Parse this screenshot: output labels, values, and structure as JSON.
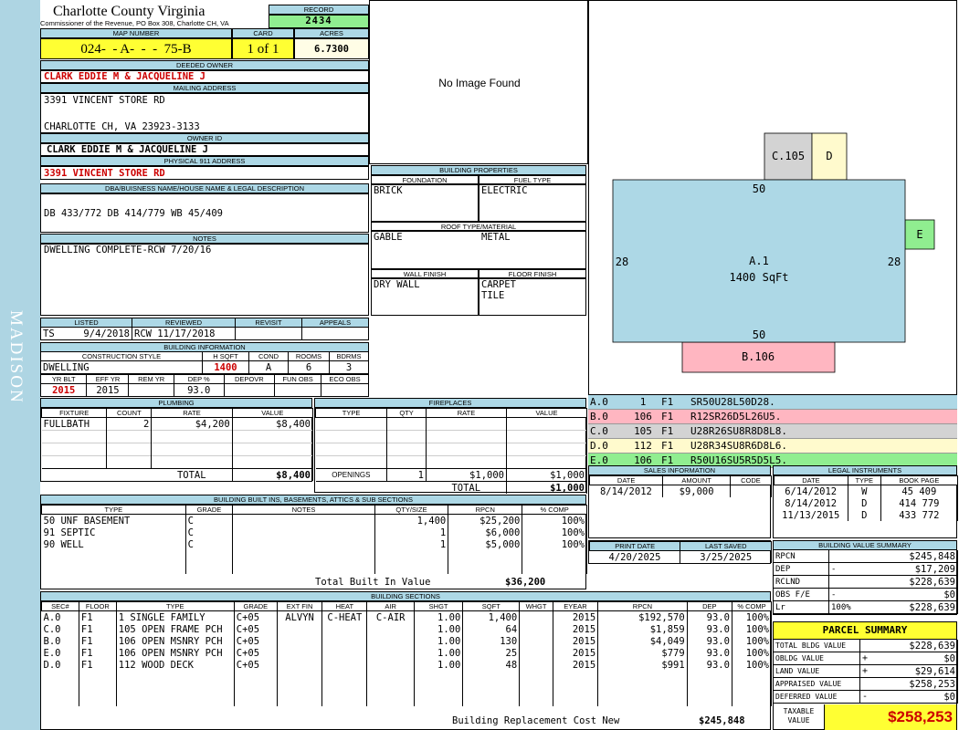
{
  "sidebar_label": "MADISON",
  "header": {
    "county": "Charlotte County Virginia",
    "commissioner": "Commissioner of the Revenue, PO Box 308, Charlotte CH, VA",
    "record_label": "RECORD",
    "record_value": "2434",
    "map_label": "MAP NUMBER",
    "map_value": "024-  - A-  -  -  75-B",
    "card_label": "CARD",
    "card_value": "1 of 1",
    "acres_label": "ACRES",
    "acres_value": "6.7300"
  },
  "owner": {
    "deeded_label": "DEEDED OWNER",
    "deeded_value": "CLARK EDDIE M & JACQUELINE J",
    "mailing_label": "MAILING ADDRESS",
    "mailing_line1": "3391 VINCENT STORE RD",
    "mailing_line2": "CHARLOTTE CH, VA 23923-3133",
    "owner_id_label": "OWNER ID",
    "owner_id_value": "CLARK EDDIE M & JACQUELINE J",
    "physical_label": "PHYSICAL 911 ADDRESS",
    "physical_value": "3391 VINCENT STORE RD",
    "dba_label": "DBA/BUISNESS NAME/HOUSE NAME & LEGAL DESCRIPTION",
    "dba_value": "DB 433/772 DB 414/779 WB 45/409",
    "notes_label": "NOTES",
    "notes_value": "DWELLING COMPLETE-RCW 7/20/16"
  },
  "image": {
    "no_image": "No Image Found"
  },
  "building_properties": {
    "title": "BUILDING PROPERTIES",
    "foundation_label": "FOUNDATION",
    "foundation_value": "BRICK",
    "fuel_label": "FUEL TYPE",
    "fuel_value": "ELECTRIC",
    "roof_label": "ROOF TYPE/MATERIAL",
    "roof_type": "GABLE",
    "roof_material": "METAL",
    "wall_label": "WALL FINISH",
    "wall_value": "DRY WALL",
    "floor_label": "FLOOR FINISH",
    "floor_value1": "CARPET",
    "floor_value2": "TILE"
  },
  "listing": {
    "listed_label": "LISTED",
    "listed_by": "TS",
    "listed_date": "9/4/2018",
    "reviewed_label": "REVIEWED",
    "reviewed_value": "RCW 11/17/2018",
    "revisit_label": "REVISIT",
    "appeals_label": "APPEALS"
  },
  "building_info": {
    "title": "BUILDING INFORMATION",
    "style_label": "CONSTRUCTION STYLE",
    "style_value": "DWELLING",
    "hsqft_label": "H SQFT",
    "hsqft_value": "1400",
    "cond_label": "COND",
    "cond_value": "A",
    "rooms_label": "ROOMS",
    "rooms_value": "6",
    "bdrms_label": "BDRMS",
    "bdrms_value": "3",
    "yrblt_label": "YR BLT",
    "yrblt_value": "2015",
    "effyr_label": "EFF YR",
    "effyr_value": "2015",
    "remyr_label": "REM YR",
    "remyr_value": "",
    "dep_label": "DEP %",
    "dep_value": "93.0",
    "depovr_label": "DEPOVR",
    "funobs_label": "FUN OBS",
    "ecoobs_label": "ECO OBS"
  },
  "plumbing": {
    "title": "PLUMBING",
    "cols": [
      "FIXTURE",
      "COUNT",
      "RATE",
      "VALUE"
    ],
    "rows": [
      {
        "fixture": "FULLBATH",
        "count": "2",
        "rate": "$4,200",
        "value": "$8,400"
      }
    ],
    "total_label": "TOTAL",
    "total_value": "$8,400"
  },
  "fireplaces": {
    "title": "FIREPLACES",
    "cols": [
      "TYPE",
      "QTY",
      "RATE",
      "VALUE"
    ],
    "openings_label": "OPENINGS",
    "openings_qty": "1",
    "openings_rate": "$1,000",
    "openings_value": "$1,000",
    "total_label": "TOTAL",
    "total_value": "$1,000"
  },
  "sketch": {
    "main_label": "A.1",
    "main_area": "1400 SqFt",
    "top_dim": "50",
    "bottom_dim": "50",
    "left_dim": "28",
    "right_dim": "28",
    "c_label": "C.105",
    "d_label": "D",
    "e_label": "E",
    "b_label": "B.106",
    "colors": {
      "main": "#add8e6",
      "c": "#d3d3d3",
      "d": "#fffacd",
      "e": "#90ee90",
      "b": "#ffb6c1"
    }
  },
  "sketch_legend": [
    {
      "code": "A.0",
      "num": "1",
      "floor": "F1",
      "path": "SR50U28L50D28.",
      "color": "#add8e6"
    },
    {
      "code": "B.0",
      "num": "106",
      "floor": "F1",
      "path": "R12SR26D5L26U5.",
      "color": "#ffb6c1"
    },
    {
      "code": "C.0",
      "num": "105",
      "floor": "F1",
      "path": "U28R26SU8R8D8L8.",
      "color": "#d3d3d3"
    },
    {
      "code": "D.0",
      "num": "112",
      "floor": "F1",
      "path": "U28R34SU8R6D8L6.",
      "color": "#fffacd"
    },
    {
      "code": "E.0",
      "num": "106",
      "floor": "F1",
      "path": "R50U16SU5R5D5L5.",
      "color": "#90ee90"
    }
  ],
  "sales": {
    "title": "SALES INFORMATION",
    "cols": [
      "DATE",
      "AMOUNT",
      "CODE"
    ],
    "rows": [
      {
        "date": "8/14/2012",
        "amount": "$9,000",
        "code": ""
      }
    ]
  },
  "legal": {
    "title": "LEGAL INSTRUMENTS",
    "cols": [
      "DATE",
      "TYPE",
      "BOOK PAGE"
    ],
    "rows": [
      {
        "date": "6/14/2012",
        "type": "W",
        "book": "45",
        "page": "409"
      },
      {
        "date": "8/14/2012",
        "type": "D",
        "book": "414",
        "page": "779"
      },
      {
        "date": "11/13/2015",
        "type": "D",
        "book": "433",
        "page": "772"
      }
    ]
  },
  "dates": {
    "print_label": "PRINT DATE",
    "print_value": "4/20/2025",
    "saved_label": "LAST SAVED",
    "saved_value": "3/25/2025"
  },
  "builtins": {
    "title": "BUILDING BUILT INS, BASEMENTS, ATTICS & SUB SECTIONS",
    "cols": [
      "TYPE",
      "GRADE",
      "NOTES",
      "QTY/SIZE",
      "RPCN",
      "% COMP"
    ],
    "rows": [
      {
        "type": "50 UNF BASEMENT",
        "grade": "C",
        "notes": "",
        "qty": "1,400",
        "rpcn": "$25,200",
        "comp": "100%"
      },
      {
        "type": "91 SEPTIC",
        "grade": "C",
        "notes": "",
        "qty": "1",
        "rpcn": "$6,000",
        "comp": "100%"
      },
      {
        "type": "90 WELL",
        "grade": "C",
        "notes": "",
        "qty": "1",
        "rpcn": "$5,000",
        "comp": "100%"
      }
    ],
    "total_label": "Total Built In Value",
    "total_value": "$36,200"
  },
  "value_summary": {
    "title": "BUILDING VALUE SUMMARY",
    "rows": [
      {
        "label": "RPCN",
        "sign": "",
        "value": "$245,848"
      },
      {
        "label": "DEP",
        "sign": "-",
        "value": "$17,209"
      },
      {
        "label": "RCLND",
        "sign": "",
        "value": "$228,639"
      },
      {
        "label": "OBS F/E",
        "sign": "-",
        "value": "$0"
      },
      {
        "label": "Lr",
        "sign": "100%",
        "value": "$228,639"
      }
    ]
  },
  "sections": {
    "title": "BUILDING SECTIONS",
    "cols": [
      "SEC#",
      "FLOOR",
      "TYPE",
      "GRADE",
      "EXT FIN",
      "HEAT",
      "AIR",
      "SHGT",
      "SQFT",
      "WHGT",
      "EYEAR",
      "RPCN",
      "DEP",
      "% COMP"
    ],
    "rows": [
      {
        "sec": "A.0",
        "floor": "F1",
        "type": "1 SINGLE FAMILY",
        "grade": "C+05",
        "ext": "ALVYN",
        "heat": "C-HEAT",
        "air": "C-AIR",
        "shgt": "1.00",
        "sqft": "1,400",
        "whgt": "",
        "eyear": "2015",
        "rpcn": "$192,570",
        "dep": "93.0",
        "comp": "100%"
      },
      {
        "sec": "C.0",
        "floor": "F1",
        "type": "105 OPEN FRAME PCH",
        "grade": "C+05",
        "ext": "",
        "heat": "",
        "air": "",
        "shgt": "1.00",
        "sqft": "64",
        "whgt": "",
        "eyear": "2015",
        "rpcn": "$1,859",
        "dep": "93.0",
        "comp": "100%"
      },
      {
        "sec": "B.0",
        "floor": "F1",
        "type": "106 OPEN MSNRY PCH",
        "grade": "C+05",
        "ext": "",
        "heat": "",
        "air": "",
        "shgt": "1.00",
        "sqft": "130",
        "whgt": "",
        "eyear": "2015",
        "rpcn": "$4,049",
        "dep": "93.0",
        "comp": "100%"
      },
      {
        "sec": "E.0",
        "floor": "F1",
        "type": "106 OPEN MSNRY PCH",
        "grade": "C+05",
        "ext": "",
        "heat": "",
        "air": "",
        "shgt": "1.00",
        "sqft": "25",
        "whgt": "",
        "eyear": "2015",
        "rpcn": "$779",
        "dep": "93.0",
        "comp": "100%"
      },
      {
        "sec": "D.0",
        "floor": "F1",
        "type": "112 WOOD DECK",
        "grade": "C+05",
        "ext": "",
        "heat": "",
        "air": "",
        "shgt": "1.00",
        "sqft": "48",
        "whgt": "",
        "eyear": "2015",
        "rpcn": "$991",
        "dep": "93.0",
        "comp": "100%"
      }
    ],
    "total_label": "Building Replacement Cost New",
    "total_value": "$245,848"
  },
  "parcel": {
    "title": "PARCEL SUMMARY",
    "rows": [
      {
        "label": "TOTAL BLDG VALUE",
        "sign": "",
        "value": "$228,639"
      },
      {
        "label": "OBLDG VALUE",
        "sign": "+",
        "value": "$0"
      },
      {
        "label": "LAND VALUE",
        "sign": "+",
        "value": "$29,614"
      },
      {
        "label": "APPRAISED VALUE",
        "sign": "",
        "value": "$258,253"
      },
      {
        "label": "DEFERRED VALUE",
        "sign": "-",
        "value": "$0"
      }
    ],
    "taxable_label": "TAXABLE VALUE",
    "taxable_value": "$258,253"
  }
}
